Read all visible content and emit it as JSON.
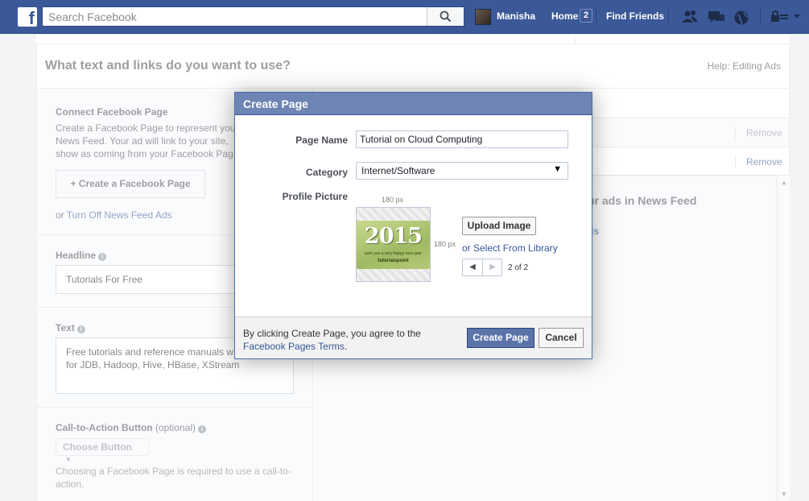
{
  "topbar": {
    "logo": "f",
    "search_placeholder": "Search Facebook",
    "user_name": "Manisha",
    "home_label": "Home",
    "home_count": "2",
    "find_friends_label": "Find Friends"
  },
  "section": {
    "title": "What text and links do you want to use?",
    "help_link": "Help: Editing Ads"
  },
  "left": {
    "connect_title": "Connect Facebook Page",
    "connect_body": "Create a Facebook Page to represent you, News Feed. Your ad will link to your site, show as coming from your Facebook Pag",
    "create_page_button": "+ Create a Facebook Page",
    "or_text": "or",
    "turn_off_link": "Turn Off News Feed Ads",
    "headline_label": "Headline",
    "headline_value": "Tutorials For Free",
    "text_label": "Text",
    "text_value": "Free tutorials and reference manuals w examples for JDB, Hadoop, Hive, HBase, XStream",
    "cta_label": "Call-to-Action Button",
    "cta_optional": "(optional)",
    "cta_select": "Choose Button",
    "cta_note": "Choosing a Facebook Page is required to use a call-to-action."
  },
  "right": {
    "remove1": "Remove",
    "remove2": "Remove",
    "preview_heading": "ur ads in News Feed",
    "preview_sub": "ds"
  },
  "modal": {
    "title": "Create Page",
    "page_name_label": "Page Name",
    "page_name_value": "Tutorial on Cloud Computing",
    "category_label": "Category",
    "category_value": "Internet/Software",
    "profile_picture_label": "Profile Picture",
    "width_hint": "180 px",
    "height_hint": "180 px",
    "image_year": "2015",
    "image_tagline": "wish you a very happy new year",
    "image_brand": "tutorialspoint",
    "upload_button": "Upload Image",
    "library_link": "or Select From Library",
    "pager_count": "2 of 2",
    "terms_text": "By clicking Create Page, you agree to the",
    "terms_link": "Facebook Pages Terms",
    "terms_end": ".",
    "create_button": "Create Page",
    "cancel_button": "Cancel"
  }
}
